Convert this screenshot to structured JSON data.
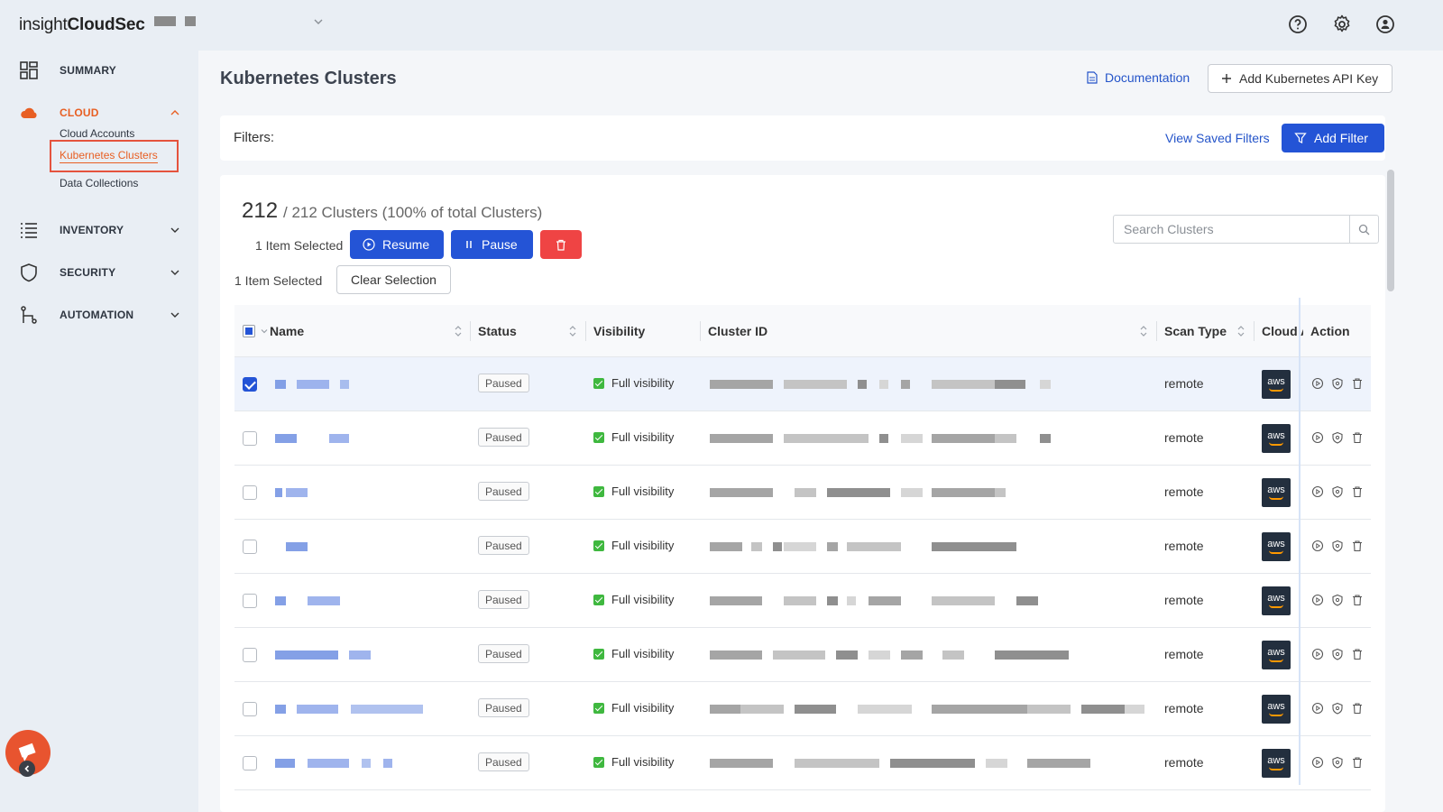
{
  "app": {
    "logo_prefix": "insight",
    "logo_suffix": "CloudSec"
  },
  "topbar": {
    "icons": [
      "help-icon",
      "settings-gear-icon",
      "user-account-icon"
    ]
  },
  "sidebar": {
    "items": [
      {
        "label": "SUMMARY",
        "icon": "dashboard-grid-icon"
      },
      {
        "label": "CLOUD",
        "icon": "cloud-icon",
        "expanded": true,
        "color": "#e85f23"
      },
      {
        "label": "INVENTORY",
        "icon": "list-icon"
      },
      {
        "label": "SECURITY",
        "icon": "shield-icon"
      },
      {
        "label": "AUTOMATION",
        "icon": "workflow-icon"
      }
    ],
    "cloud_sub": [
      "Cloud Accounts",
      "Kubernetes Clusters",
      "Data Collections"
    ],
    "active_sub": "Kubernetes Clusters"
  },
  "page": {
    "title": "Kubernetes Clusters",
    "documentation_label": "Documentation",
    "add_key_label": "Add Kubernetes API Key"
  },
  "filters": {
    "label": "Filters:",
    "view_saved_label": "View Saved Filters",
    "add_filter_label": "Add Filter"
  },
  "summary": {
    "count": "212",
    "rest": "/ 212 Clusters (100% of total Clusters)",
    "selected_text_1": "1 Item Selected",
    "selected_text_2": "1 Item Selected",
    "resume_label": "Resume",
    "pause_label": "Pause",
    "clear_selection_label": "Clear Selection"
  },
  "search": {
    "placeholder": "Search Clusters"
  },
  "table": {
    "columns": [
      "Name",
      "Status",
      "Visibility",
      "Cluster ID",
      "Scan Type",
      "Cloud A",
      "Action"
    ],
    "rows": [
      {
        "status": "Paused",
        "visibility": "Full visibility",
        "scan_type": "remote",
        "cloud": "aws",
        "selected": true
      },
      {
        "status": "Paused",
        "visibility": "Full visibility",
        "scan_type": "remote",
        "cloud": "aws",
        "selected": false
      },
      {
        "status": "Paused",
        "visibility": "Full visibility",
        "scan_type": "remote",
        "cloud": "aws",
        "selected": false
      },
      {
        "status": "Paused",
        "visibility": "Full visibility",
        "scan_type": "remote",
        "cloud": "aws",
        "selected": false
      },
      {
        "status": "Paused",
        "visibility": "Full visibility",
        "scan_type": "remote",
        "cloud": "aws",
        "selected": false
      },
      {
        "status": "Paused",
        "visibility": "Full visibility",
        "scan_type": "remote",
        "cloud": "aws",
        "selected": false
      },
      {
        "status": "Paused",
        "visibility": "Full visibility",
        "scan_type": "remote",
        "cloud": "aws",
        "selected": false
      },
      {
        "status": "Paused",
        "visibility": "Full visibility",
        "scan_type": "remote",
        "cloud": "aws",
        "selected": false
      }
    ]
  },
  "colors": {
    "accent": "#2454d6",
    "active_nav": "#e85f23",
    "danger": "#ef4444",
    "status_ok": "#3fb83f"
  }
}
